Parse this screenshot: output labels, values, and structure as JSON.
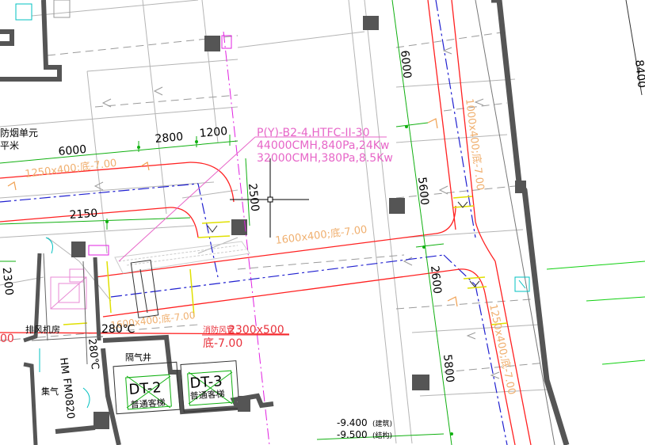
{
  "colors": {
    "background": "#ffffff",
    "wall": "#555555",
    "duct_red": "#ff2020",
    "dim_green": "#10b010",
    "centerline_blue": "#2020d0",
    "magenta": "#e020e0",
    "orange_text": "#f0b070",
    "pink_text": "#e766c8",
    "yellow": "#e0e000",
    "cyan": "#00c0c0"
  },
  "labels": {
    "fan_line1": "P(Y)-B2-4,HTFC-II-30",
    "fan_line2": "44000CMH,840Pa,24Kw",
    "fan_line3": "32000CMH,380Pa,8.5Kw",
    "duct_main": "1600x400;底-7.00",
    "duct_left": "1250x400;底-7.00",
    "duct_right_top": "1000x400;底-7.00",
    "duct_right_bottom": "1250x400;底-7.00",
    "duct_mid_bottom": "1600x400;底-7.00",
    "duct_red_label1": "2300x500",
    "duct_red_label1_prefix": "消防风管",
    "duct_red_label2": "底-7.00",
    "duct_left_edge": "00",
    "temp": "280℃",
    "temp2": "280℃",
    "room_exhaust": "排风机房",
    "room_shaft": "隔气井",
    "room_gas": "集气",
    "elevator1": "DT-2",
    "elevator1_sub": "普通客梯",
    "elevator2": "DT-3",
    "elevator2_sub": "普通客梯",
    "fm_door": "FM0820",
    "hm_door": "HM",
    "level1": "-9.400",
    "level1_note": "(建筑)",
    "level2": "-9.500",
    "level2_note": "(结构)",
    "topleft1": "防烟单元",
    "topleft2": "平米",
    "dim_6000_top": "6000",
    "dim_6000_left": "6000",
    "dim_2800": "2800",
    "dim_1200": "1200",
    "dim_2500": "2500",
    "dim_2150": "2150",
    "dim_5600": "5600",
    "dim_2600": "2600",
    "dim_5800": "5800",
    "dim_2300": "2300",
    "dim_8400": "8400"
  }
}
